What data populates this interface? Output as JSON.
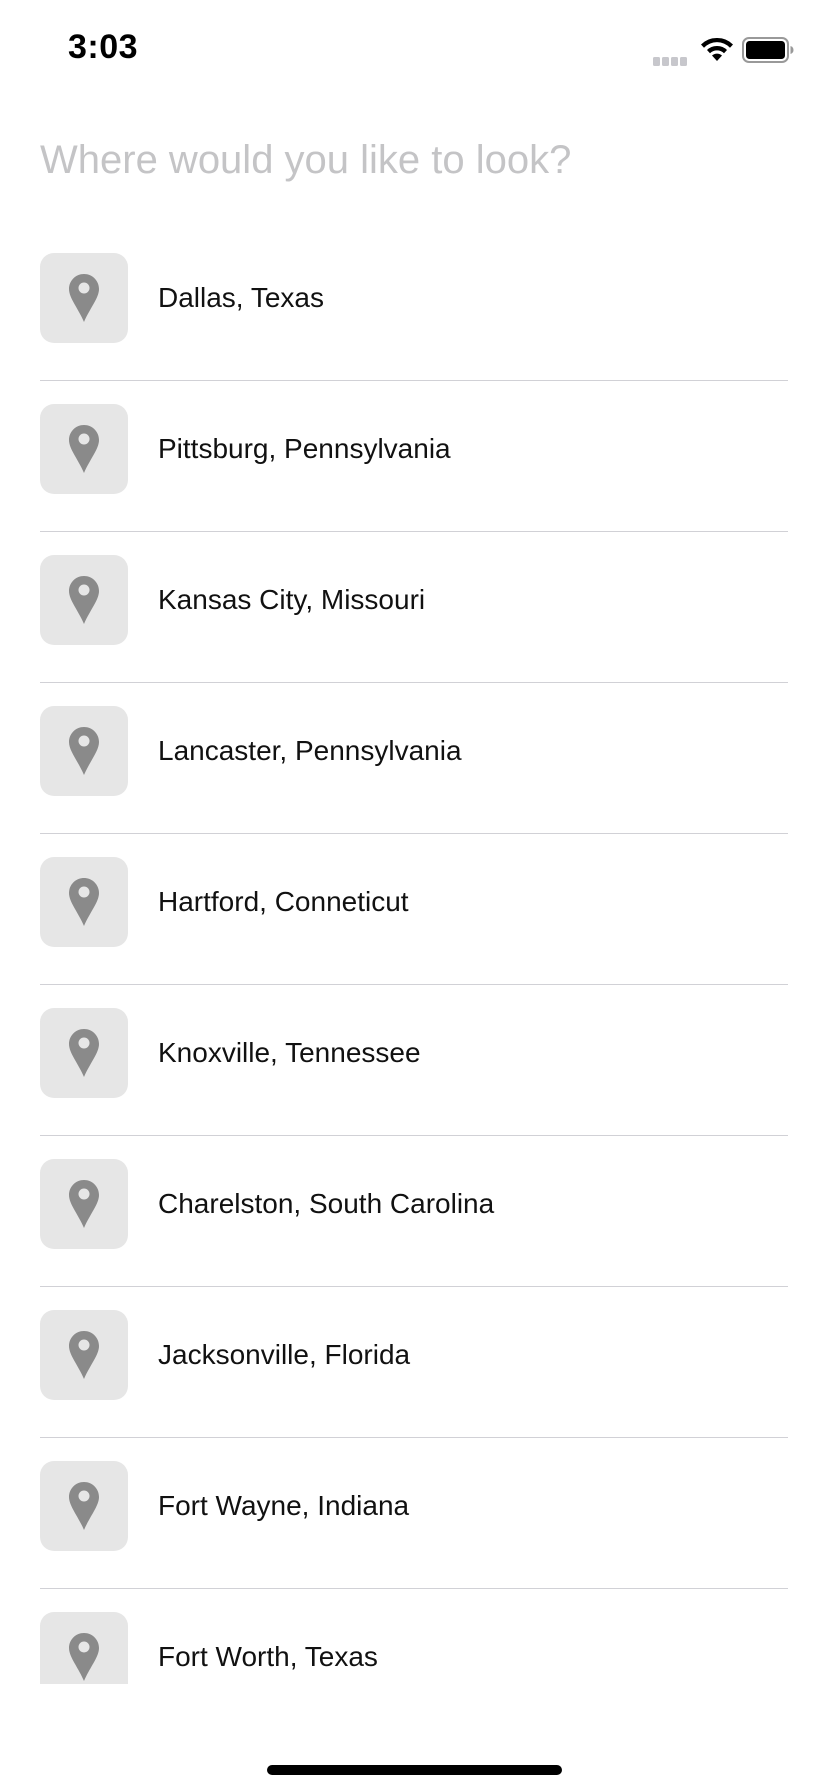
{
  "status_bar": {
    "time": "3:03",
    "signal_icon": "cellular-signal-icon",
    "wifi_icon": "wifi-icon",
    "battery_icon": "battery-icon"
  },
  "search": {
    "placeholder": "Where would you like to look?",
    "value": ""
  },
  "results": {
    "icon": "map-pin-icon",
    "items": [
      {
        "label": "Dallas, Texas"
      },
      {
        "label": "Pittsburg, Pennsylvania"
      },
      {
        "label": "Kansas City, Missouri"
      },
      {
        "label": "Lancaster, Pennsylvania"
      },
      {
        "label": "Hartford, Conneticut"
      },
      {
        "label": "Knoxville, Tennessee"
      },
      {
        "label": "Charelston, South Carolina"
      },
      {
        "label": "Jacksonville, Florida"
      },
      {
        "label": "Fort Wayne, Indiana"
      },
      {
        "label": "Fort Worth, Texas"
      }
    ]
  },
  "colors": {
    "icon_tile": "#e6e6e6",
    "pin": "#8a8a8a",
    "separator": "#d1d1d6",
    "placeholder": "#c4c4c6"
  }
}
